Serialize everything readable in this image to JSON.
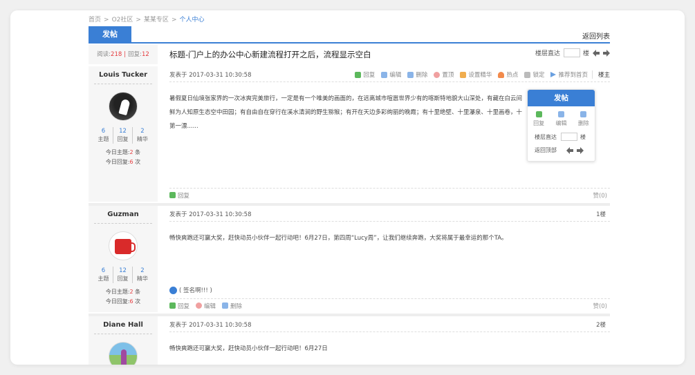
{
  "breadcrumb": {
    "items": [
      "首页",
      "O2社区",
      "某某专区"
    ],
    "current": "个人中心",
    "separator": ">"
  },
  "toolbar": {
    "post_label": "发帖",
    "back_list_label": "返回列表"
  },
  "thread": {
    "views_label": "阅读:",
    "views": "218",
    "replies_label": "回复:",
    "replies": "12",
    "title": "标题-门户上的办公中心新建流程打开之后，流程显示空白",
    "jump_label": "楼层直达",
    "jump_suffix": "楼"
  },
  "user_stat_labels": {
    "topics": "主题",
    "replies": "回复",
    "essence": "精华"
  },
  "today_labels": {
    "topics": "今日主题:",
    "topics_unit": "条",
    "replies": "今日回复:",
    "replies_unit": "次"
  },
  "posts": [
    {
      "author": "Louis Tucker",
      "stats": {
        "topics": "6",
        "replies": "12",
        "essence": "2"
      },
      "today_topics": "2",
      "today_replies": "6",
      "meta": "发表于 2017-03-31 10:30:58",
      "floor": "楼主",
      "tools": [
        "回复",
        "编辑",
        "删除",
        "置顶",
        "设置精华",
        "热点",
        "锁定",
        "推荐到首页"
      ],
      "content_lines": [
        "暑假夏日仙境张家界的一次冰爽完美旅行，一定是有一个唯美的画面的，在远离城市喧嚣世界少有的喀斯特地貌大山深处，有藏在白云间",
        "鲜为人知原生态空中田园；有自由自在穿行在溪水清涧的野生猕猴；有开在天边多彩绚丽的晚霞；有十里绝壁、十里瀑泉、十里画卷，十",
        "第一漂......"
      ],
      "footer_reply": "回复",
      "zan": "赞(0)"
    },
    {
      "author": "Guzman",
      "stats": {
        "topics": "6",
        "replies": "12",
        "essence": "2"
      },
      "today_topics": "2",
      "today_replies": "6",
      "meta": "发表于 2017-03-31 10:30:58",
      "floor": "1楼",
      "content": "畅快爽跑还可赢大奖，赶快动员小伙伴一起行动吧！6月27日，第四周“Lucy周”，让我们继续奔跑，大奖将属于最幸运的那个TA。",
      "signature": "( 签名啊!!! )",
      "footer_tools": [
        "回复",
        "编辑",
        "删除"
      ],
      "zan": "赞(0)"
    },
    {
      "author": "Diane Hall",
      "meta": "发表于 2017-03-31 10:30:58",
      "floor": "2楼",
      "content": "畅快爽跑还可赢大奖，赶快动员小伙伴一起行动吧！6月27日"
    }
  ],
  "float_panel": {
    "post_label": "发帖",
    "actions": [
      "回复",
      "编辑",
      "删除"
    ],
    "jump_label": "楼层直达",
    "jump_suffix": "楼",
    "top_label": "返回顶部"
  },
  "colors": {
    "accent": "#3a7fd5",
    "highlight": "#e4393c"
  }
}
